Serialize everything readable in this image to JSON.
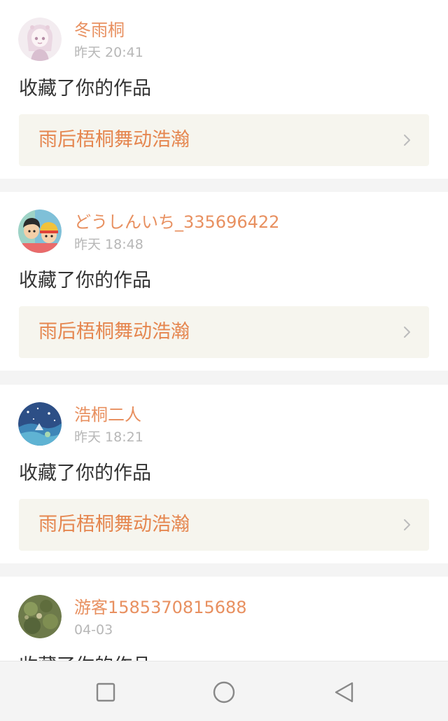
{
  "feed": [
    {
      "username": "冬雨桐",
      "time": "昨天 20:41",
      "action": "收藏了你的作品",
      "work_title": "雨后梧桐舞动浩瀚",
      "avatar_icon": "anime-girl-avatar"
    },
    {
      "username": "どうしんいち_335696422",
      "time": "昨天 18:48",
      "action": "收藏了你的作品",
      "work_title": "雨后梧桐舞动浩瀚",
      "avatar_icon": "cartoon-kids-avatar"
    },
    {
      "username": "浩桐二人",
      "time": "昨天 18:21",
      "action": "收藏了你的作品",
      "work_title": "雨后梧桐舞动浩瀚",
      "avatar_icon": "starry-sky-avatar"
    },
    {
      "username": "游客1585370815688",
      "time": "04-03",
      "action": "收藏了你的作品",
      "avatar_icon": "nature-photo-avatar"
    }
  ],
  "navbar": {
    "icons": [
      "square-icon",
      "circle-icon",
      "triangle-back-icon"
    ]
  },
  "colors": {
    "username": "#e89060",
    "work_title": "#e5864f",
    "work_bg": "#f6f5ee",
    "time": "#b7b7b7",
    "separator": "#f4f4f4"
  }
}
